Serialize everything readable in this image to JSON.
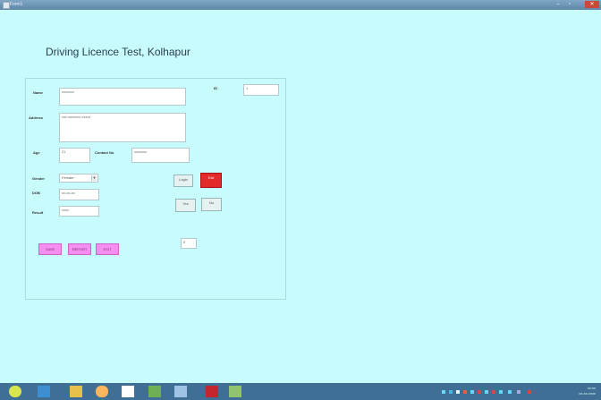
{
  "window": {
    "title": "Form1",
    "btn_min": "–",
    "btn_max": "▫",
    "btn_close": "✕"
  },
  "form": {
    "title": "Driving Licence Test, Kolhapur"
  },
  "fields": {
    "name": {
      "label": "Name",
      "value": "xxxxxxx"
    },
    "id": {
      "label": "ID",
      "value": "1"
    },
    "address": {
      "label": "Address",
      "value": "xxx xxxxxxx xxxxx"
    },
    "age": {
      "label": "Age",
      "value": "21"
    },
    "contact": {
      "label": "Contact No",
      "value": "xxxxxxx"
    },
    "gender": {
      "label": "Gender",
      "value": "Female"
    },
    "date": {
      "label": "DOB",
      "value": "xx-xx-xx"
    },
    "result": {
      "label": "Result",
      "value": "xxxx"
    }
  },
  "buttons": {
    "left_top": "Login",
    "red": "Exit",
    "left_bottom": "Yes",
    "right_bottom": "No",
    "save": "SAVE",
    "report": "REPORT",
    "exit": "EXIT",
    "small": "0"
  },
  "taskbar": {
    "clock_time": "xx:xx",
    "clock_date": "xx-xx-xxxx",
    "icons": [
      "start-icon",
      "ie-icon",
      "folder-icon",
      "media-icon",
      "word-icon",
      "paint-icon",
      "vs-icon",
      "pdf-icon",
      "app-icon"
    ]
  }
}
